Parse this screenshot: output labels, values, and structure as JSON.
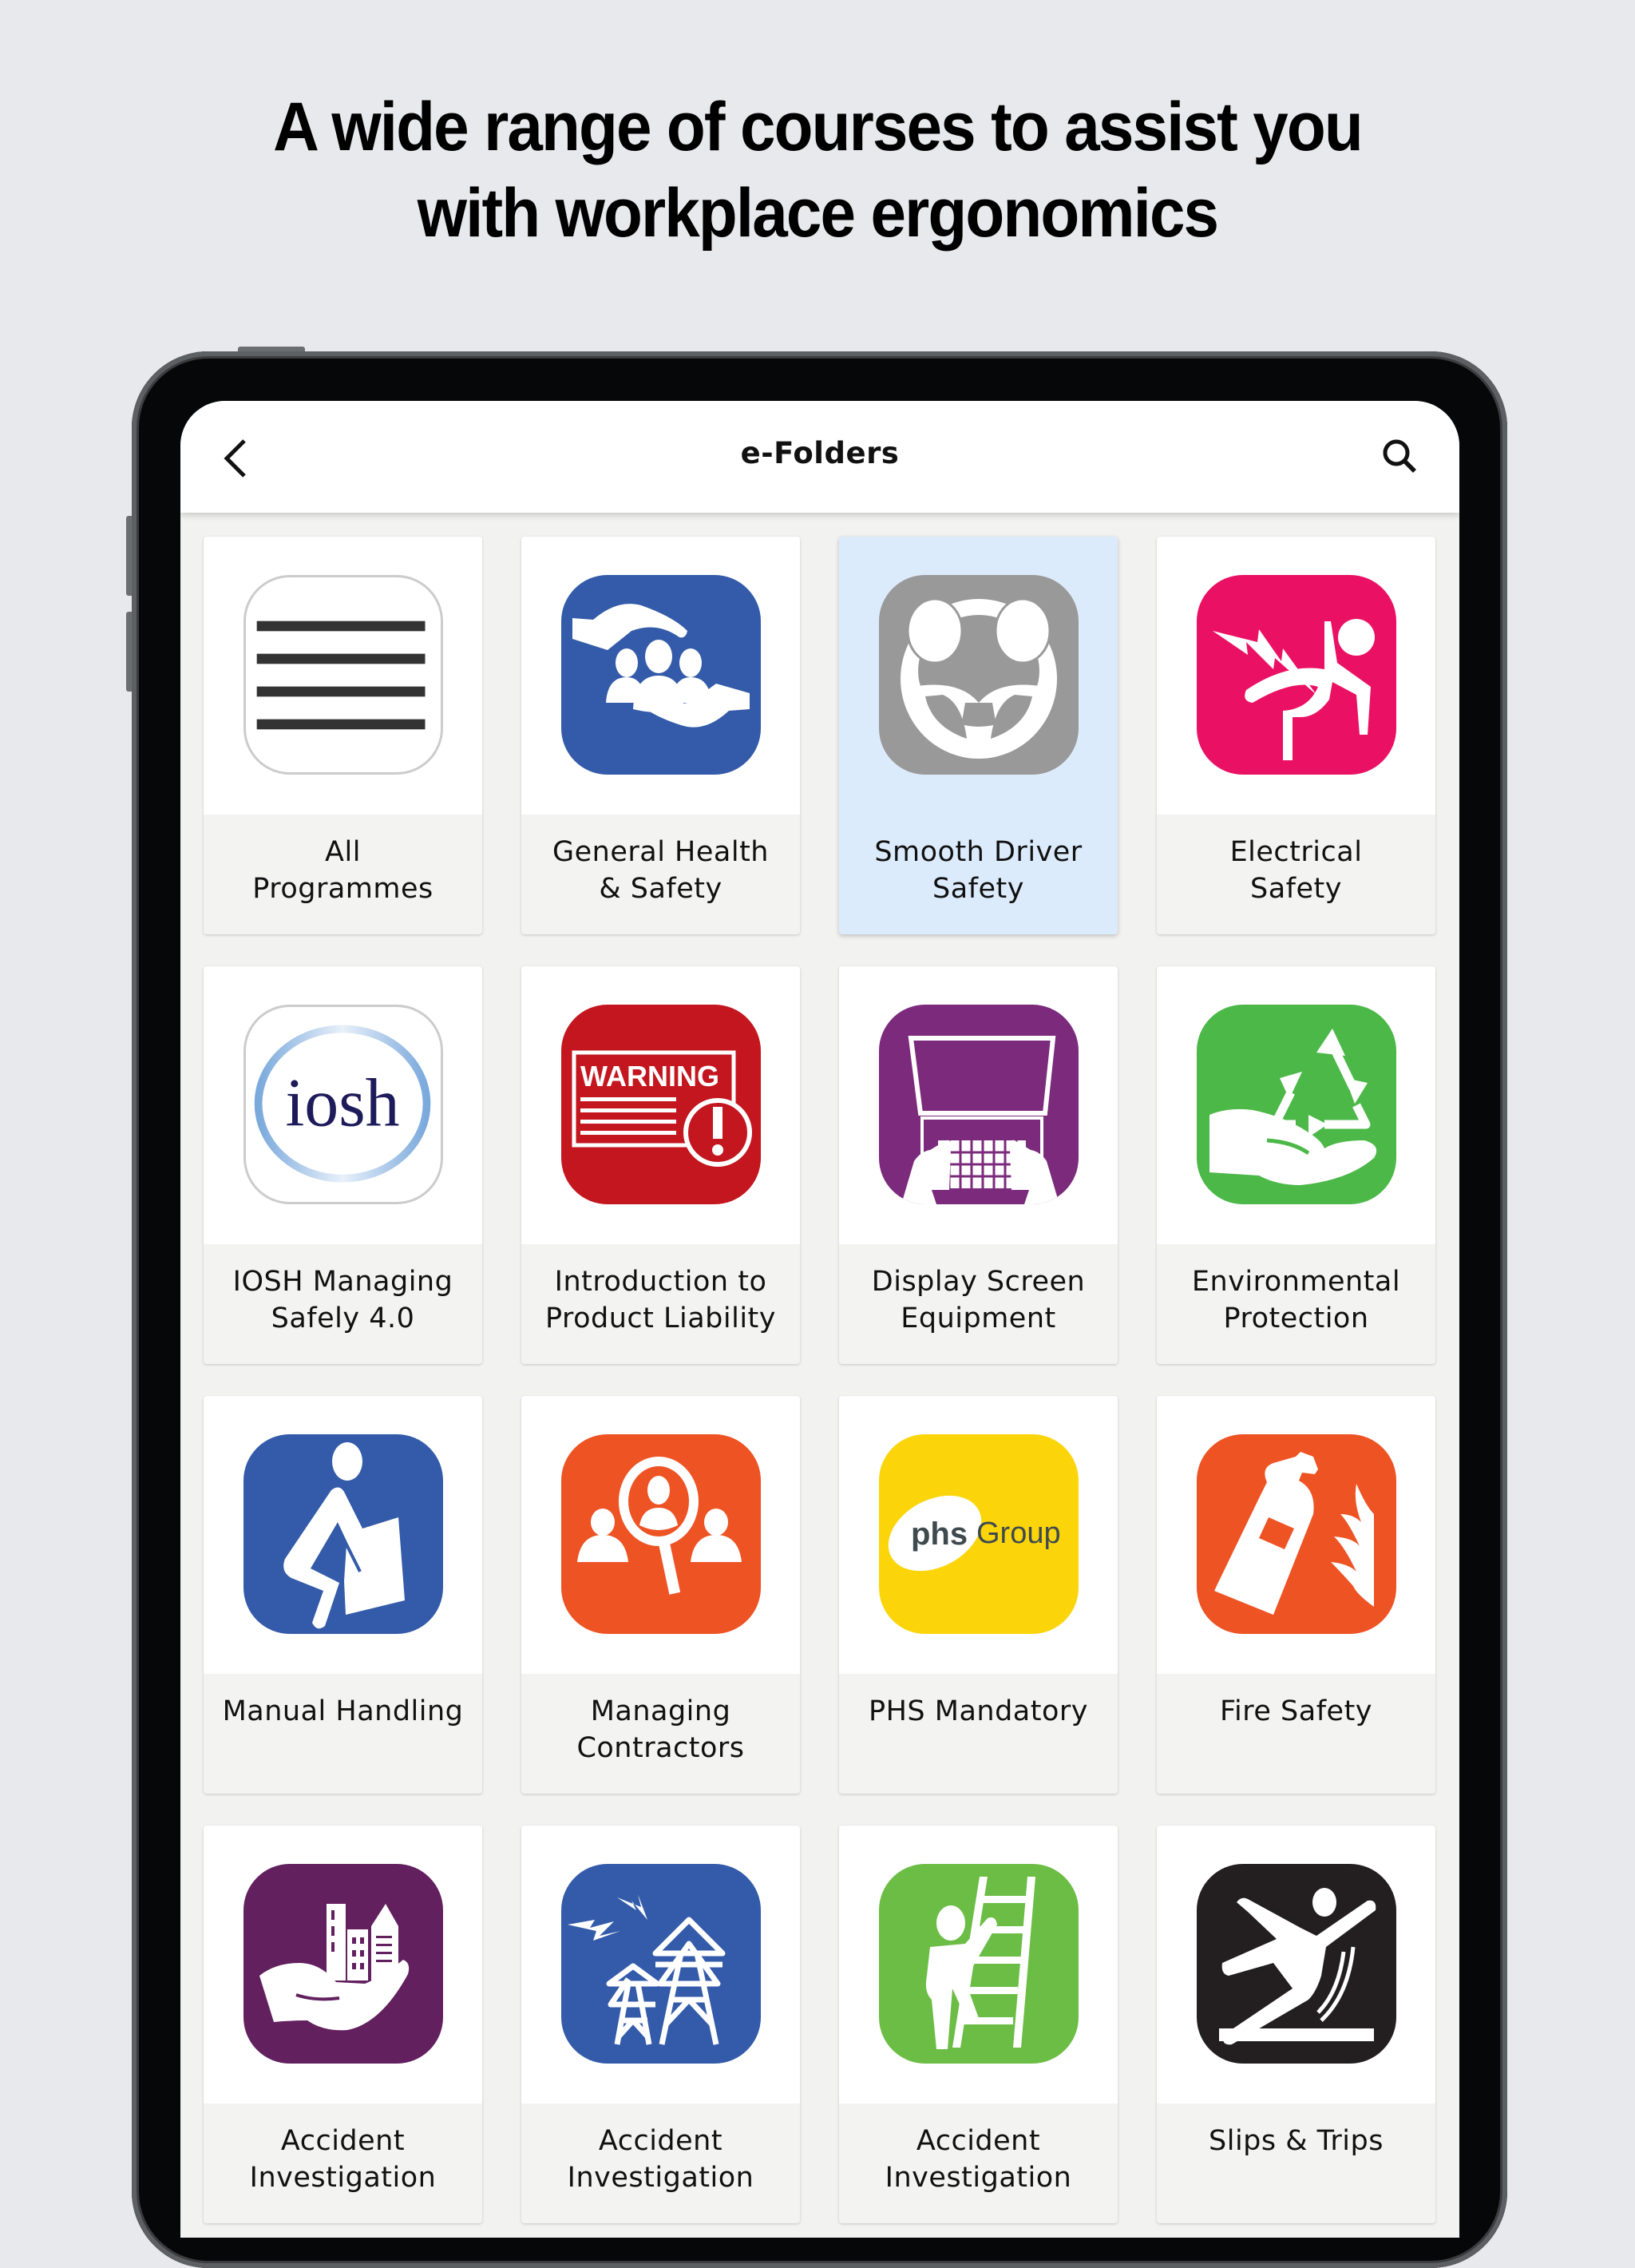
{
  "headline": {
    "line1": "A wide range of courses to assist you",
    "line2": "with workplace ergonomics"
  },
  "appbar": {
    "title": "e-Folders",
    "back_icon": "chevron-left-icon",
    "search_icon": "search-icon"
  },
  "colors": {
    "background": "#e8e9ec",
    "selected_tile": "#dcebfb",
    "blue": "#345ba9",
    "pink": "#ea1164",
    "gray": "#999999",
    "red": "#c3161f",
    "purple": "#7b2a7c",
    "green": "#4cb848",
    "orange": "#ee5324",
    "yellow": "#fbd50a",
    "dark_purple": "#62205f",
    "light_green": "#6cbd45",
    "black": "#231f20"
  },
  "folders": [
    {
      "label_1": "All",
      "label_2": "Programmes",
      "icon": "menu-lines-icon",
      "selected": false
    },
    {
      "label_1": "General Health",
      "label_2": "& Safety",
      "icon": "hands-protecting-people-icon",
      "selected": false
    },
    {
      "label_1": "Smooth Driver",
      "label_2": "Safety",
      "icon": "steering-wheel-airbag-icon",
      "selected": true
    },
    {
      "label_1": "Electrical",
      "label_2": "Safety",
      "icon": "electric-shock-icon",
      "selected": false
    },
    {
      "label_1": "IOSH Managing",
      "label_2": "Safely 4.0",
      "icon": "iosh-logo-icon",
      "logo_text": "iosh",
      "selected": false
    },
    {
      "label_1": "Introduction to",
      "label_2": "Product Liability",
      "icon": "warning-sign-icon",
      "logo_text": "WARNING",
      "selected": false
    },
    {
      "label_1": "Display Screen",
      "label_2": "Equipment",
      "icon": "laptop-typing-icon",
      "selected": false
    },
    {
      "label_1": "Environmental",
      "label_2": "Protection",
      "icon": "recycle-hand-icon",
      "selected": false
    },
    {
      "label_1": "Manual Handling",
      "label_2": "",
      "icon": "person-lifting-box-icon",
      "selected": false
    },
    {
      "label_1": "Managing",
      "label_2": "Contractors",
      "icon": "magnifier-people-icon",
      "selected": false
    },
    {
      "label_1": "PHS Mandatory",
      "label_2": "",
      "icon": "phs-group-logo-icon",
      "logo_text_1": "phs",
      "logo_text_2": "Group",
      "selected": false
    },
    {
      "label_1": "Fire Safety",
      "label_2": "",
      "icon": "fire-extinguisher-icon",
      "selected": false
    },
    {
      "label_1": "Accident",
      "label_2": "Investigation",
      "icon": "hand-holding-buildings-icon",
      "selected": false
    },
    {
      "label_1": "Accident",
      "label_2": "Investigation",
      "icon": "power-pylons-icon",
      "selected": false
    },
    {
      "label_1": "Accident",
      "label_2": "Investigation",
      "icon": "ladder-climber-icon",
      "selected": false
    },
    {
      "label_1": "Slips & Trips",
      "label_2": "",
      "icon": "person-slipping-icon",
      "selected": false
    }
  ]
}
